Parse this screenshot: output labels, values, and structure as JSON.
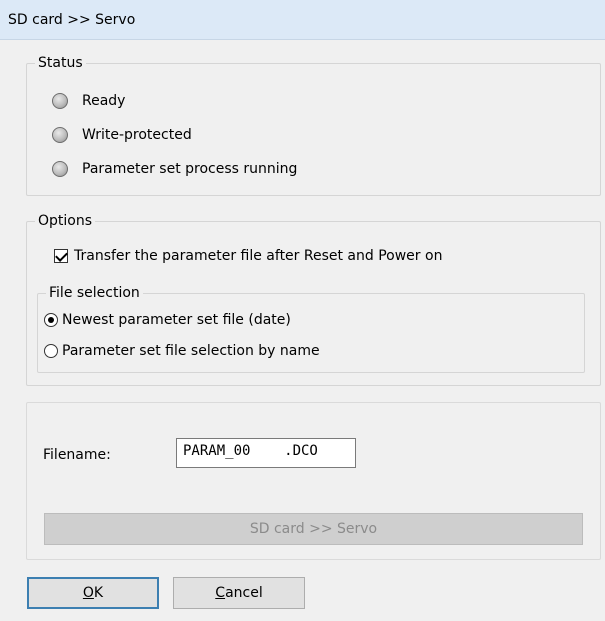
{
  "window": {
    "title": "SD card >> Servo"
  },
  "status": {
    "label": "Status",
    "items": [
      {
        "label": "Ready"
      },
      {
        "label": "Write-protected"
      },
      {
        "label": "Parameter set process running"
      }
    ]
  },
  "options": {
    "label": "Options",
    "transfer_checkbox": {
      "label": "Transfer the parameter file after Reset and Power on",
      "checked": true
    },
    "file_selection": {
      "label": "File selection",
      "radios": [
        {
          "label": "Newest parameter set file (date)",
          "selected": true
        },
        {
          "label": "Parameter set file selection by name",
          "selected": false
        }
      ]
    }
  },
  "filename": {
    "label": "Filename:",
    "value": "PARAM_00    .DCO"
  },
  "action_button": {
    "label": "SD card >> Servo",
    "enabled": false
  },
  "footer": {
    "ok_label": "OK",
    "cancel_label": "Cancel"
  }
}
